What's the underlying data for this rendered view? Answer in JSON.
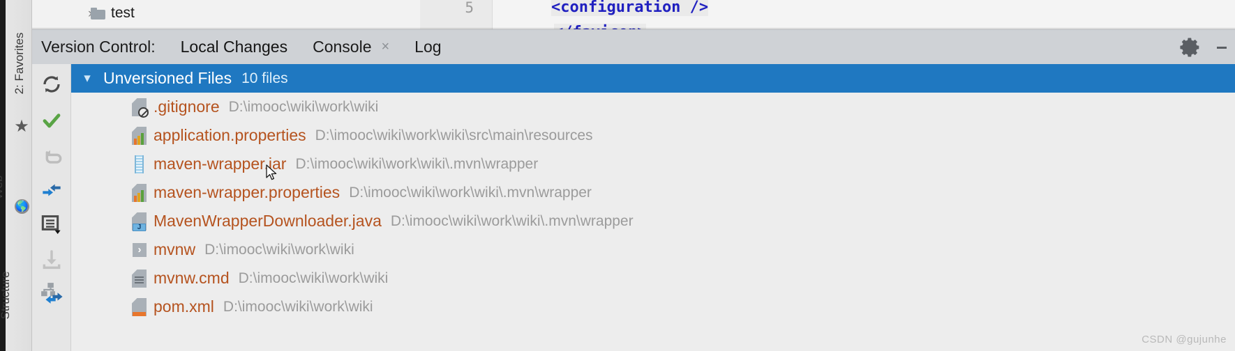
{
  "editor": {
    "tree_item": "test",
    "tree_chevron": "chevron-right",
    "gutter_line": "5",
    "code_line_1": "<configuration />",
    "code_line_2": "</favicon>"
  },
  "tabbar": {
    "title": "Version Control:",
    "tabs": [
      {
        "label": "Local Changes",
        "active": true,
        "closable": false
      },
      {
        "label": "Console",
        "active": false,
        "closable": true,
        "close_glyph": "×"
      },
      {
        "label": "Log",
        "active": false,
        "closable": false
      }
    ],
    "settings_label": "gear-icon",
    "hide_label": "hide-icon"
  },
  "sidebar": {
    "items": [
      {
        "label": "2: Favorites",
        "icon": "star-icon",
        "mnemonic": "2"
      },
      {
        "label": "Web",
        "icon": "globe-icon"
      },
      {
        "label": "Structure",
        "icon": null
      }
    ]
  },
  "toolbar": {
    "buttons": [
      {
        "name": "refresh-button",
        "icon": "refresh-icon",
        "enabled": true
      },
      {
        "name": "commit-button",
        "icon": "checkmark-icon",
        "enabled": true
      },
      {
        "name": "rollback-button",
        "icon": "undo-icon",
        "enabled": false
      },
      {
        "name": "diff-button",
        "icon": "compare-arrows-icon",
        "enabled": true
      },
      {
        "name": "group-by-button",
        "icon": "list-dropdown-icon",
        "enabled": true
      },
      {
        "name": "get-from-vcs-button",
        "icon": "download-icon",
        "enabled": false
      },
      {
        "name": "shelve-button",
        "icon": "shelve-hierarchy-icon",
        "enabled": true
      }
    ]
  },
  "changes": {
    "group": {
      "title": "Unversioned Files",
      "count_label": "10 files",
      "expanded": true,
      "chevron": "chevron-down",
      "highlight_color": "#1f78c1"
    },
    "filename_color": "#b5531f",
    "path_color": "#9b9b9b",
    "files": [
      {
        "name": ".gitignore",
        "path": "D:\\imooc\\wiki\\work\\wiki",
        "icon": "file-ignored-icon"
      },
      {
        "name": "application.properties",
        "path": "D:\\imooc\\wiki\\work\\wiki\\src\\main\\resources",
        "icon": "properties-file-icon"
      },
      {
        "name": "maven-wrapper.jar",
        "path": "D:\\imooc\\wiki\\work\\wiki\\.mvn\\wrapper",
        "icon": "jar-file-icon"
      },
      {
        "name": "maven-wrapper.properties",
        "path": "D:\\imooc\\wiki\\work\\wiki\\.mvn\\wrapper",
        "icon": "properties-file-icon"
      },
      {
        "name": "MavenWrapperDownloader.java",
        "path": "D:\\imooc\\wiki\\work\\wiki\\.mvn\\wrapper",
        "icon": "java-file-icon"
      },
      {
        "name": "mvnw",
        "path": "D:\\imooc\\wiki\\work\\wiki",
        "icon": "shell-script-icon"
      },
      {
        "name": "mvnw.cmd",
        "path": "D:\\imooc\\wiki\\work\\wiki",
        "icon": "text-file-icon"
      },
      {
        "name": "pom.xml",
        "path": "D:\\imooc\\wiki\\work\\wiki",
        "icon": "maven-pom-icon"
      }
    ]
  },
  "watermark": "CSDN @gujunhe"
}
